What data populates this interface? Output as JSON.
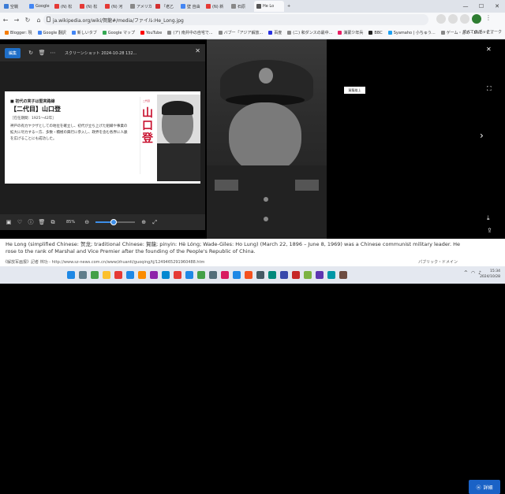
{
  "browser": {
    "tabs": [
      {
        "label": "空戦",
        "color": "#3b7bd6"
      },
      {
        "label": "Google",
        "color": "#4285f4"
      },
      {
        "label": "(N) 松",
        "color": "#e53935"
      },
      {
        "label": "(N) 松",
        "color": "#e53935"
      },
      {
        "label": "(N) 河",
        "color": "#e53935"
      },
      {
        "label": "アメリカ",
        "color": "#888"
      },
      {
        "label": "「老乙",
        "color": "#d32f2f"
      },
      {
        "label": "壁 自由",
        "color": "#4285f4"
      },
      {
        "label": "(N) 新",
        "color": "#e53935"
      },
      {
        "label": "石原",
        "color": "#888"
      },
      {
        "label": "He Lo",
        "color": "#555",
        "active": true
      }
    ],
    "url": "ja.wikipedia.org/wiki/賀龍#/media/ファイル:He_Long.jpg",
    "bookmarks": [
      {
        "label": "Blogger: 現",
        "color": "#f57c00"
      },
      {
        "label": "Google 翻訳",
        "color": "#4285f4"
      },
      {
        "label": "新しいタブ",
        "color": "#4285f4"
      },
      {
        "label": "Google マップ",
        "color": "#34a853"
      },
      {
        "label": "YouTube",
        "color": "#ff0000"
      },
      {
        "label": "(ア) 南井中の自宅で...",
        "color": "#888"
      },
      {
        "label": "バブー「アジア解放...",
        "color": "#888"
      },
      {
        "label": "百度",
        "color": "#2932e1"
      },
      {
        "label": "(ニ) 和ダンスの最中...",
        "color": "#888"
      },
      {
        "label": "満蒙少年兵",
        "color": "#e91e63"
      },
      {
        "label": "BBC",
        "color": "#222"
      },
      {
        "label": "Syamaho | 小ちゅう...",
        "color": "#1da1f2"
      },
      {
        "label": "ゲーム・おめ・DVD・C...",
        "color": "#888"
      }
    ],
    "all_bookmarks": "すべてのブックマーク"
  },
  "snip": {
    "edit_label": "編集",
    "title": "スクリーンショット 2024-10-28 132...",
    "zoom": "85%",
    "zoom_fraction": 0.45,
    "doc": {
      "subtitle": "■ 初代の実子は堅実路線",
      "name": "【二代目】山口登",
      "term": "［在任期間：1925〜42年］",
      "body": "神戸の有力ヤクザとしての地位を確立し、初代が立ち上げた組織や事業の拡大に尽力する一方、多数・積極の興行に参入し、政界を含む各界に人脈を広げることにも成功した。",
      "red_label": "二代目",
      "red_name": "山口登"
    }
  },
  "viewer": {
    "tag": "賀龍雄上"
  },
  "caption": {
    "text": "He Long (simplified Chinese: 贺龙; traditional Chinese: 賀龍; pinyin: Hè Lóng; Wade-Giles: Ho Lung) (March 22, 1896 – June 8, 1969) was a Chinese communist military leader. He rose to the rank of Marshal and Vice Premier after the founding of the People's Republic of China.",
    "detail_label": "詳細",
    "credit_left": "《解放军画报》記者 林功 - http://www.sz-news.com.cn/www/zhuanti/guoqing/tj/1249465291960488.htm",
    "credit_right": "パブリック・ドメイン"
  },
  "taskbar": {
    "time": "15:34",
    "date": "2024/10/28",
    "icons": [
      "#1e88e5",
      "#607d8b",
      "#43a047",
      "#fbc02d",
      "#e53935",
      "#1e88e5",
      "#fb8c00",
      "#8e24aa",
      "#0288d1",
      "#e53935",
      "#1e88e5",
      "#43a047",
      "#546e7a",
      "#d81b60",
      "#1e88e5",
      "#f4511e",
      "#455a64",
      "#00897b",
      "#3949ab",
      "#c62828",
      "#7cb342",
      "#5e35b1",
      "#0097a7",
      "#6d4c41"
    ]
  }
}
